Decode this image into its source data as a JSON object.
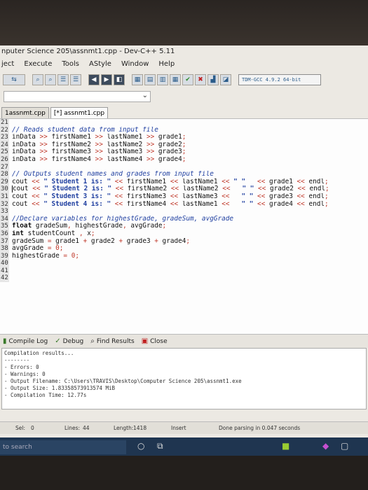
{
  "window": {
    "title": "nputer Science 205\\assnmt1.cpp - Dev-C++ 5.11"
  },
  "menu": [
    "ject",
    "Execute",
    "Tools",
    "AStyle",
    "Window",
    "Help"
  ],
  "toolbar": {
    "compiler": "TDM-GCC 4.9.2 64-bit"
  },
  "tabs": [
    {
      "label": "1assnmt.cpp"
    },
    {
      "label": "[*] assnmt1.cpp"
    }
  ],
  "editor": {
    "lines": [
      {
        "n": "21",
        "html": ""
      },
      {
        "n": "22",
        "html": "<span class=\"cm\">// Reads student data from input file</span>"
      },
      {
        "n": "23",
        "html": "inData <span class=\"op\">&gt;&gt;</span> firstName1 <span class=\"op\">&gt;&gt;</span> lastName1 <span class=\"op\">&gt;&gt;</span> grade1<span class=\"op\">;</span>"
      },
      {
        "n": "24",
        "html": "inData <span class=\"op\">&gt;&gt;</span> firstName2 <span class=\"op\">&gt;&gt;</span> lastName2 <span class=\"op\">&gt;&gt;</span> grade2<span class=\"op\">;</span>"
      },
      {
        "n": "25",
        "html": "inData <span class=\"op\">&gt;&gt;</span> firstName3 <span class=\"op\">&gt;&gt;</span> lastName3 <span class=\"op\">&gt;&gt;</span> grade3<span class=\"op\">;</span>"
      },
      {
        "n": "26",
        "html": "inData <span class=\"op\">&gt;&gt;</span> firstName4 <span class=\"op\">&gt;&gt;</span> lastName4 <span class=\"op\">&gt;&gt;</span> grade4<span class=\"op\">;</span>"
      },
      {
        "n": "27",
        "html": ""
      },
      {
        "n": "28",
        "html": "<span class=\"cm\">// Outputs student names and grades from input file</span>"
      },
      {
        "n": "29",
        "html": "cout <span class=\"op\">&lt;&lt;</span> <span class=\"st\">\" Student 1 is: \"</span> <span class=\"op\">&lt;&lt;</span> firstName1 <span class=\"op\">&lt;&lt;</span> lastName1 <span class=\"op\">&lt;&lt;</span> <span class=\"st\">\" \"</span>   <span class=\"op\">&lt;&lt;</span> grade1 <span class=\"op\">&lt;&lt;</span> endl<span class=\"op\">;</span>"
      },
      {
        "n": "30",
        "html": "<span class=\"cursor-mark\"></span>cout <span class=\"op\">&lt;&lt;</span> <span class=\"st\">\" Student 2 is: \"</span> <span class=\"op\">&lt;&lt;</span> firstName2 <span class=\"op\">&lt;&lt;</span> lastName2 <span class=\"op\">&lt;&lt;</span>   <span class=\"st\">\" \"</span> <span class=\"op\">&lt;&lt;</span> grade2 <span class=\"op\">&lt;&lt;</span> endl<span class=\"op\">;</span>"
      },
      {
        "n": "31",
        "html": "cout <span class=\"op\">&lt;&lt;</span> <span class=\"st\">\" Student 3 is: \"</span> <span class=\"op\">&lt;&lt;</span> firstName3 <span class=\"op\">&lt;&lt;</span> lastName3 <span class=\"op\">&lt;&lt;</span>   <span class=\"st\">\" \"</span> <span class=\"op\">&lt;&lt;</span> grade3 <span class=\"op\">&lt;&lt;</span> endl<span class=\"op\">;</span>"
      },
      {
        "n": "32",
        "html": "cout <span class=\"op\">&lt;&lt;</span> <span class=\"st\">\" Student 4 is: \"</span> <span class=\"op\">&lt;&lt;</span> firstName4 <span class=\"op\">&lt;&lt;</span> lastName1 <span class=\"op\">&lt;&lt;</span>   <span class=\"st\">\" \"</span> <span class=\"op\">&lt;&lt;</span> grade4 <span class=\"op\">&lt;&lt;</span> endl<span class=\"op\">;</span>"
      },
      {
        "n": "33",
        "html": ""
      },
      {
        "n": "34",
        "html": "<span class=\"cm\">//Declare variables for highestGrade, gradeSum, avgGrade</span>"
      },
      {
        "n": "35",
        "html": "<span class=\"kw\">float</span> gradeSum<span class=\"op\">,</span> highestGrade<span class=\"op\">,</span> avgGrade<span class=\"op\">;</span>"
      },
      {
        "n": "36",
        "html": "<span class=\"kw\">int</span> studentCount <span class=\"op\">,</span> x<span class=\"op\">;</span>"
      },
      {
        "n": "37",
        "html": "gradeSum <span class=\"op\">=</span> grade1 <span class=\"op\">+</span> grade2 <span class=\"op\">+</span> grade3 <span class=\"op\">+</span> grade4<span class=\"op\">;</span>"
      },
      {
        "n": "38",
        "html": "avgGrade <span class=\"op\">=</span> <span class=\"nm\">0</span><span class=\"op\">;</span>"
      },
      {
        "n": "39",
        "html": "highestGrade <span class=\"op\">=</span> <span class=\"nm\">0</span><span class=\"op\">;</span>"
      },
      {
        "n": "40",
        "html": ""
      },
      {
        "n": "41",
        "html": ""
      },
      {
        "n": "42",
        "html": ""
      }
    ]
  },
  "bottom_tabs": {
    "compile_log": "Compile Log",
    "debug": "Debug",
    "find_results": "Find Results",
    "close": "Close"
  },
  "output": {
    "lines": [
      "Compilation results...",
      "--------",
      "- Errors: 0",
      "- Warnings: 0",
      "- Output Filename: C:\\Users\\TRAVIS\\Desktop\\Computer Science 205\\assnmt1.exe",
      "- Output Size: 1.83358573913574 MiB",
      "- Compilation Time: 12.77s"
    ]
  },
  "status": {
    "sel": "Sel:",
    "sel_value": "0",
    "lines": "Lines:",
    "lines_value": "44",
    "length": "Length:",
    "length_value": "1418",
    "mode": "Insert",
    "message": "Done parsing in 0.047 seconds"
  },
  "taskbar": {
    "search_placeholder": "to search"
  }
}
